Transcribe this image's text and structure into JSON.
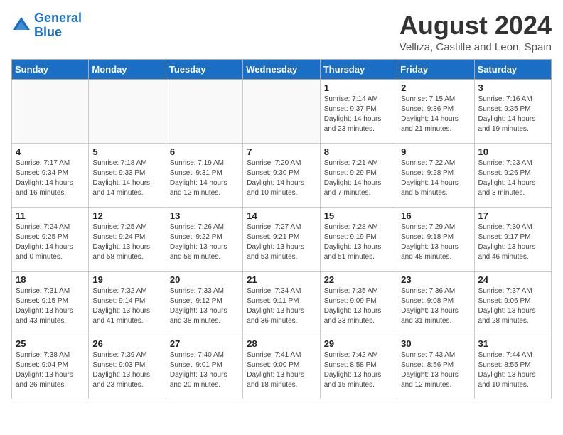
{
  "logo": {
    "line1": "General",
    "line2": "Blue"
  },
  "title": "August 2024",
  "subtitle": "Velliza, Castille and Leon, Spain",
  "weekdays": [
    "Sunday",
    "Monday",
    "Tuesday",
    "Wednesday",
    "Thursday",
    "Friday",
    "Saturday"
  ],
  "weeks": [
    [
      {
        "day": "",
        "info": ""
      },
      {
        "day": "",
        "info": ""
      },
      {
        "day": "",
        "info": ""
      },
      {
        "day": "",
        "info": ""
      },
      {
        "day": "1",
        "info": "Sunrise: 7:14 AM\nSunset: 9:37 PM\nDaylight: 14 hours\nand 23 minutes."
      },
      {
        "day": "2",
        "info": "Sunrise: 7:15 AM\nSunset: 9:36 PM\nDaylight: 14 hours\nand 21 minutes."
      },
      {
        "day": "3",
        "info": "Sunrise: 7:16 AM\nSunset: 9:35 PM\nDaylight: 14 hours\nand 19 minutes."
      }
    ],
    [
      {
        "day": "4",
        "info": "Sunrise: 7:17 AM\nSunset: 9:34 PM\nDaylight: 14 hours\nand 16 minutes."
      },
      {
        "day": "5",
        "info": "Sunrise: 7:18 AM\nSunset: 9:33 PM\nDaylight: 14 hours\nand 14 minutes."
      },
      {
        "day": "6",
        "info": "Sunrise: 7:19 AM\nSunset: 9:31 PM\nDaylight: 14 hours\nand 12 minutes."
      },
      {
        "day": "7",
        "info": "Sunrise: 7:20 AM\nSunset: 9:30 PM\nDaylight: 14 hours\nand 10 minutes."
      },
      {
        "day": "8",
        "info": "Sunrise: 7:21 AM\nSunset: 9:29 PM\nDaylight: 14 hours\nand 7 minutes."
      },
      {
        "day": "9",
        "info": "Sunrise: 7:22 AM\nSunset: 9:28 PM\nDaylight: 14 hours\nand 5 minutes."
      },
      {
        "day": "10",
        "info": "Sunrise: 7:23 AM\nSunset: 9:26 PM\nDaylight: 14 hours\nand 3 minutes."
      }
    ],
    [
      {
        "day": "11",
        "info": "Sunrise: 7:24 AM\nSunset: 9:25 PM\nDaylight: 14 hours\nand 0 minutes."
      },
      {
        "day": "12",
        "info": "Sunrise: 7:25 AM\nSunset: 9:24 PM\nDaylight: 13 hours\nand 58 minutes."
      },
      {
        "day": "13",
        "info": "Sunrise: 7:26 AM\nSunset: 9:22 PM\nDaylight: 13 hours\nand 56 minutes."
      },
      {
        "day": "14",
        "info": "Sunrise: 7:27 AM\nSunset: 9:21 PM\nDaylight: 13 hours\nand 53 minutes."
      },
      {
        "day": "15",
        "info": "Sunrise: 7:28 AM\nSunset: 9:19 PM\nDaylight: 13 hours\nand 51 minutes."
      },
      {
        "day": "16",
        "info": "Sunrise: 7:29 AM\nSunset: 9:18 PM\nDaylight: 13 hours\nand 48 minutes."
      },
      {
        "day": "17",
        "info": "Sunrise: 7:30 AM\nSunset: 9:17 PM\nDaylight: 13 hours\nand 46 minutes."
      }
    ],
    [
      {
        "day": "18",
        "info": "Sunrise: 7:31 AM\nSunset: 9:15 PM\nDaylight: 13 hours\nand 43 minutes."
      },
      {
        "day": "19",
        "info": "Sunrise: 7:32 AM\nSunset: 9:14 PM\nDaylight: 13 hours\nand 41 minutes."
      },
      {
        "day": "20",
        "info": "Sunrise: 7:33 AM\nSunset: 9:12 PM\nDaylight: 13 hours\nand 38 minutes."
      },
      {
        "day": "21",
        "info": "Sunrise: 7:34 AM\nSunset: 9:11 PM\nDaylight: 13 hours\nand 36 minutes."
      },
      {
        "day": "22",
        "info": "Sunrise: 7:35 AM\nSunset: 9:09 PM\nDaylight: 13 hours\nand 33 minutes."
      },
      {
        "day": "23",
        "info": "Sunrise: 7:36 AM\nSunset: 9:08 PM\nDaylight: 13 hours\nand 31 minutes."
      },
      {
        "day": "24",
        "info": "Sunrise: 7:37 AM\nSunset: 9:06 PM\nDaylight: 13 hours\nand 28 minutes."
      }
    ],
    [
      {
        "day": "25",
        "info": "Sunrise: 7:38 AM\nSunset: 9:04 PM\nDaylight: 13 hours\nand 26 minutes."
      },
      {
        "day": "26",
        "info": "Sunrise: 7:39 AM\nSunset: 9:03 PM\nDaylight: 13 hours\nand 23 minutes."
      },
      {
        "day": "27",
        "info": "Sunrise: 7:40 AM\nSunset: 9:01 PM\nDaylight: 13 hours\nand 20 minutes."
      },
      {
        "day": "28",
        "info": "Sunrise: 7:41 AM\nSunset: 9:00 PM\nDaylight: 13 hours\nand 18 minutes."
      },
      {
        "day": "29",
        "info": "Sunrise: 7:42 AM\nSunset: 8:58 PM\nDaylight: 13 hours\nand 15 minutes."
      },
      {
        "day": "30",
        "info": "Sunrise: 7:43 AM\nSunset: 8:56 PM\nDaylight: 13 hours\nand 12 minutes."
      },
      {
        "day": "31",
        "info": "Sunrise: 7:44 AM\nSunset: 8:55 PM\nDaylight: 13 hours\nand 10 minutes."
      }
    ]
  ]
}
